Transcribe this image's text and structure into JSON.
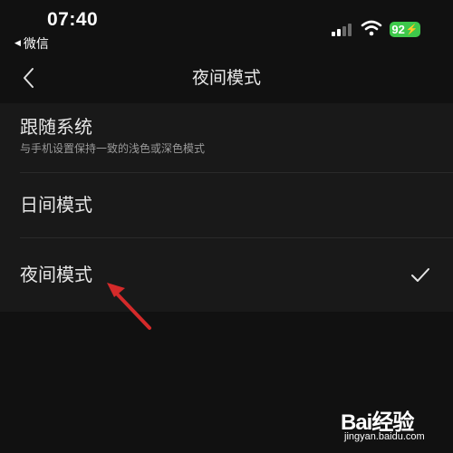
{
  "status_bar": {
    "time": "07:40",
    "back_to_app": "微信",
    "battery_level": "92",
    "icons": [
      "cellular-signal-icon",
      "wifi-icon",
      "battery-charging-icon"
    ]
  },
  "nav": {
    "back_icon": "chevron-left-icon",
    "title": "夜间模式"
  },
  "options": [
    {
      "label": "跟随系统",
      "description": "与手机设置保持一致的浅色或深色模式",
      "selected": false
    },
    {
      "label": "日间模式",
      "selected": false
    },
    {
      "label": "夜间模式",
      "selected": true
    }
  ],
  "selected_icon": "checkmark-icon",
  "annotation_icon": "red-arrow-icon",
  "watermark": {
    "brand": "Bai经验",
    "url": "jingyan.baidu.com"
  },
  "colors": {
    "background": "#111111",
    "list_background": "#191919",
    "battery": "#3ec84b",
    "annotation_arrow": "#d42a2a"
  }
}
